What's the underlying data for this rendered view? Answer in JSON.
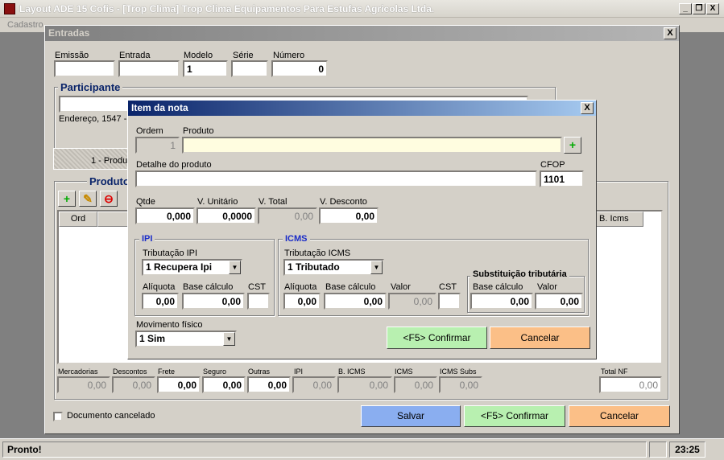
{
  "app": {
    "title": "Layout ADE 15 Cofis - [Trop Clima] Trop Clima Equipamentos Para Estufas Agricolas Ltda.",
    "menu_visible": "Cadastro",
    "minimize": "_",
    "restore": "❐",
    "close": "X"
  },
  "entradas": {
    "title": "Entradas",
    "close": "X",
    "header_fields": {
      "emissao_label": "Emissão",
      "emissao": "",
      "entrada_label": "Entrada",
      "entrada": "",
      "modelo_label": "Modelo",
      "modelo": "1",
      "serie_label": "Série",
      "serie": "",
      "numero_label": "Número",
      "numero": "0"
    },
    "participante": {
      "title": "Participante",
      "value": "",
      "address": "Endereço, 1547 -"
    },
    "tab_label": "1 - Produt",
    "produtos_title": "Produto",
    "grid_headers": {
      "ord": "Ord",
      "b_icms": "B. Icms"
    },
    "totals": {
      "mercadorias_label": "Mercadorias",
      "mercadorias": "0,00",
      "descontos_label": "Descontos",
      "descontos": "0,00",
      "frete_label": "Frete",
      "frete": "0,00",
      "seguro_label": "Seguro",
      "seguro": "0,00",
      "outras_label": "Outras",
      "outras": "0,00",
      "ipi_label": "IPI",
      "ipi": "0,00",
      "bicms_label": "B. ICMS",
      "bicms": "0,00",
      "icms_label": "ICMS",
      "icms": "0,00",
      "icms_subs_label": "ICMS Subs",
      "icms_subs": "0,00",
      "total_nf_label": "Total NF",
      "total_nf": "0,00"
    },
    "documento_cancelado": "Documento cancelado",
    "salvar": "Salvar",
    "confirmar": "<F5> Confirmar",
    "cancelar": "Cancelar"
  },
  "item_nota": {
    "title": "Item da nota",
    "close": "X",
    "ordem_label": "Ordem",
    "ordem": "1",
    "produto_label": "Produto",
    "produto": "",
    "detalhe_label": "Detalhe do produto",
    "detalhe": "",
    "cfop_label": "CFOP",
    "cfop": "1101",
    "qtde_label": "Qtde",
    "qtde": "0,000",
    "vunit_label": "V. Unitário",
    "vunit": "0,0000",
    "vtotal_label": "V. Total",
    "vtotal": "0,00",
    "vdesc_label": "V. Desconto",
    "vdesc": "0,00",
    "ipi": {
      "title": "IPI",
      "trib_label": "Tributação IPI",
      "trib": "1 Recupera Ipi",
      "aliq_label": "Alíquota",
      "aliq": "0,00",
      "base_label": "Base cálculo",
      "base": "0,00",
      "cst_label": "CST",
      "cst": ""
    },
    "icms": {
      "title": "ICMS",
      "trib_label": "Tributação ICMS",
      "trib": "1 Tributado",
      "aliq_label": "Alíquota",
      "aliq": "0,00",
      "base_label": "Base cálculo",
      "base": "0,00",
      "valor_label": "Valor",
      "valor": "0,00",
      "cst_label": "CST",
      "cst": ""
    },
    "st": {
      "title": "Substituição tributária",
      "base_label": "Base cálculo",
      "base": "0,00",
      "valor_label": "Valor",
      "valor": "0,00"
    },
    "mov_label": "Movimento físico",
    "mov": "1 Sim",
    "confirmar": "<F5> Confirmar",
    "cancelar": "Cancelar"
  },
  "status": {
    "text": "Pronto!",
    "time": "23:25"
  }
}
